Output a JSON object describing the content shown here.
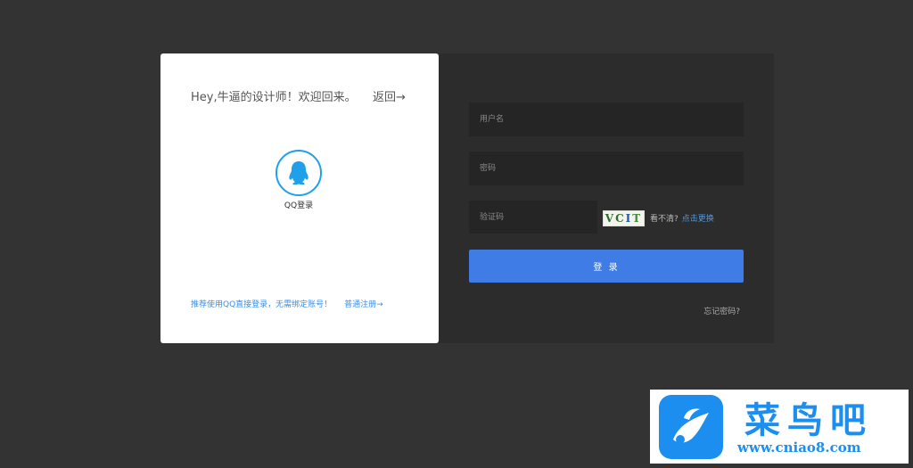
{
  "left_card": {
    "greeting": "Hey,牛逼的设计师！欢迎回来。",
    "back_link": "返回→",
    "qq_label": "QQ登录",
    "recommend_text": "推荐使用QQ直接登录，无需绑定账号！",
    "register_link": "普通注册→"
  },
  "form": {
    "username_placeholder": "用户名",
    "password_placeholder": "密码",
    "captcha_placeholder": "验证码",
    "captcha_chars": [
      "VC",
      "I",
      "T"
    ],
    "captcha_hint": "看不清?",
    "captcha_refresh": "点击更换",
    "login_label": "登 录",
    "forgot_label": "忘记密码?"
  },
  "watermark": {
    "title": "菜鸟吧",
    "url": "www.cniao8.com"
  },
  "colors": {
    "background": "#333333",
    "accent": "#3f7ce6",
    "qq_blue": "#1fa0e8",
    "link_blue": "#3a8ee6"
  },
  "icons": {
    "qq": "qq-penguin-icon",
    "watermark_logo": "bird-logo-icon"
  }
}
